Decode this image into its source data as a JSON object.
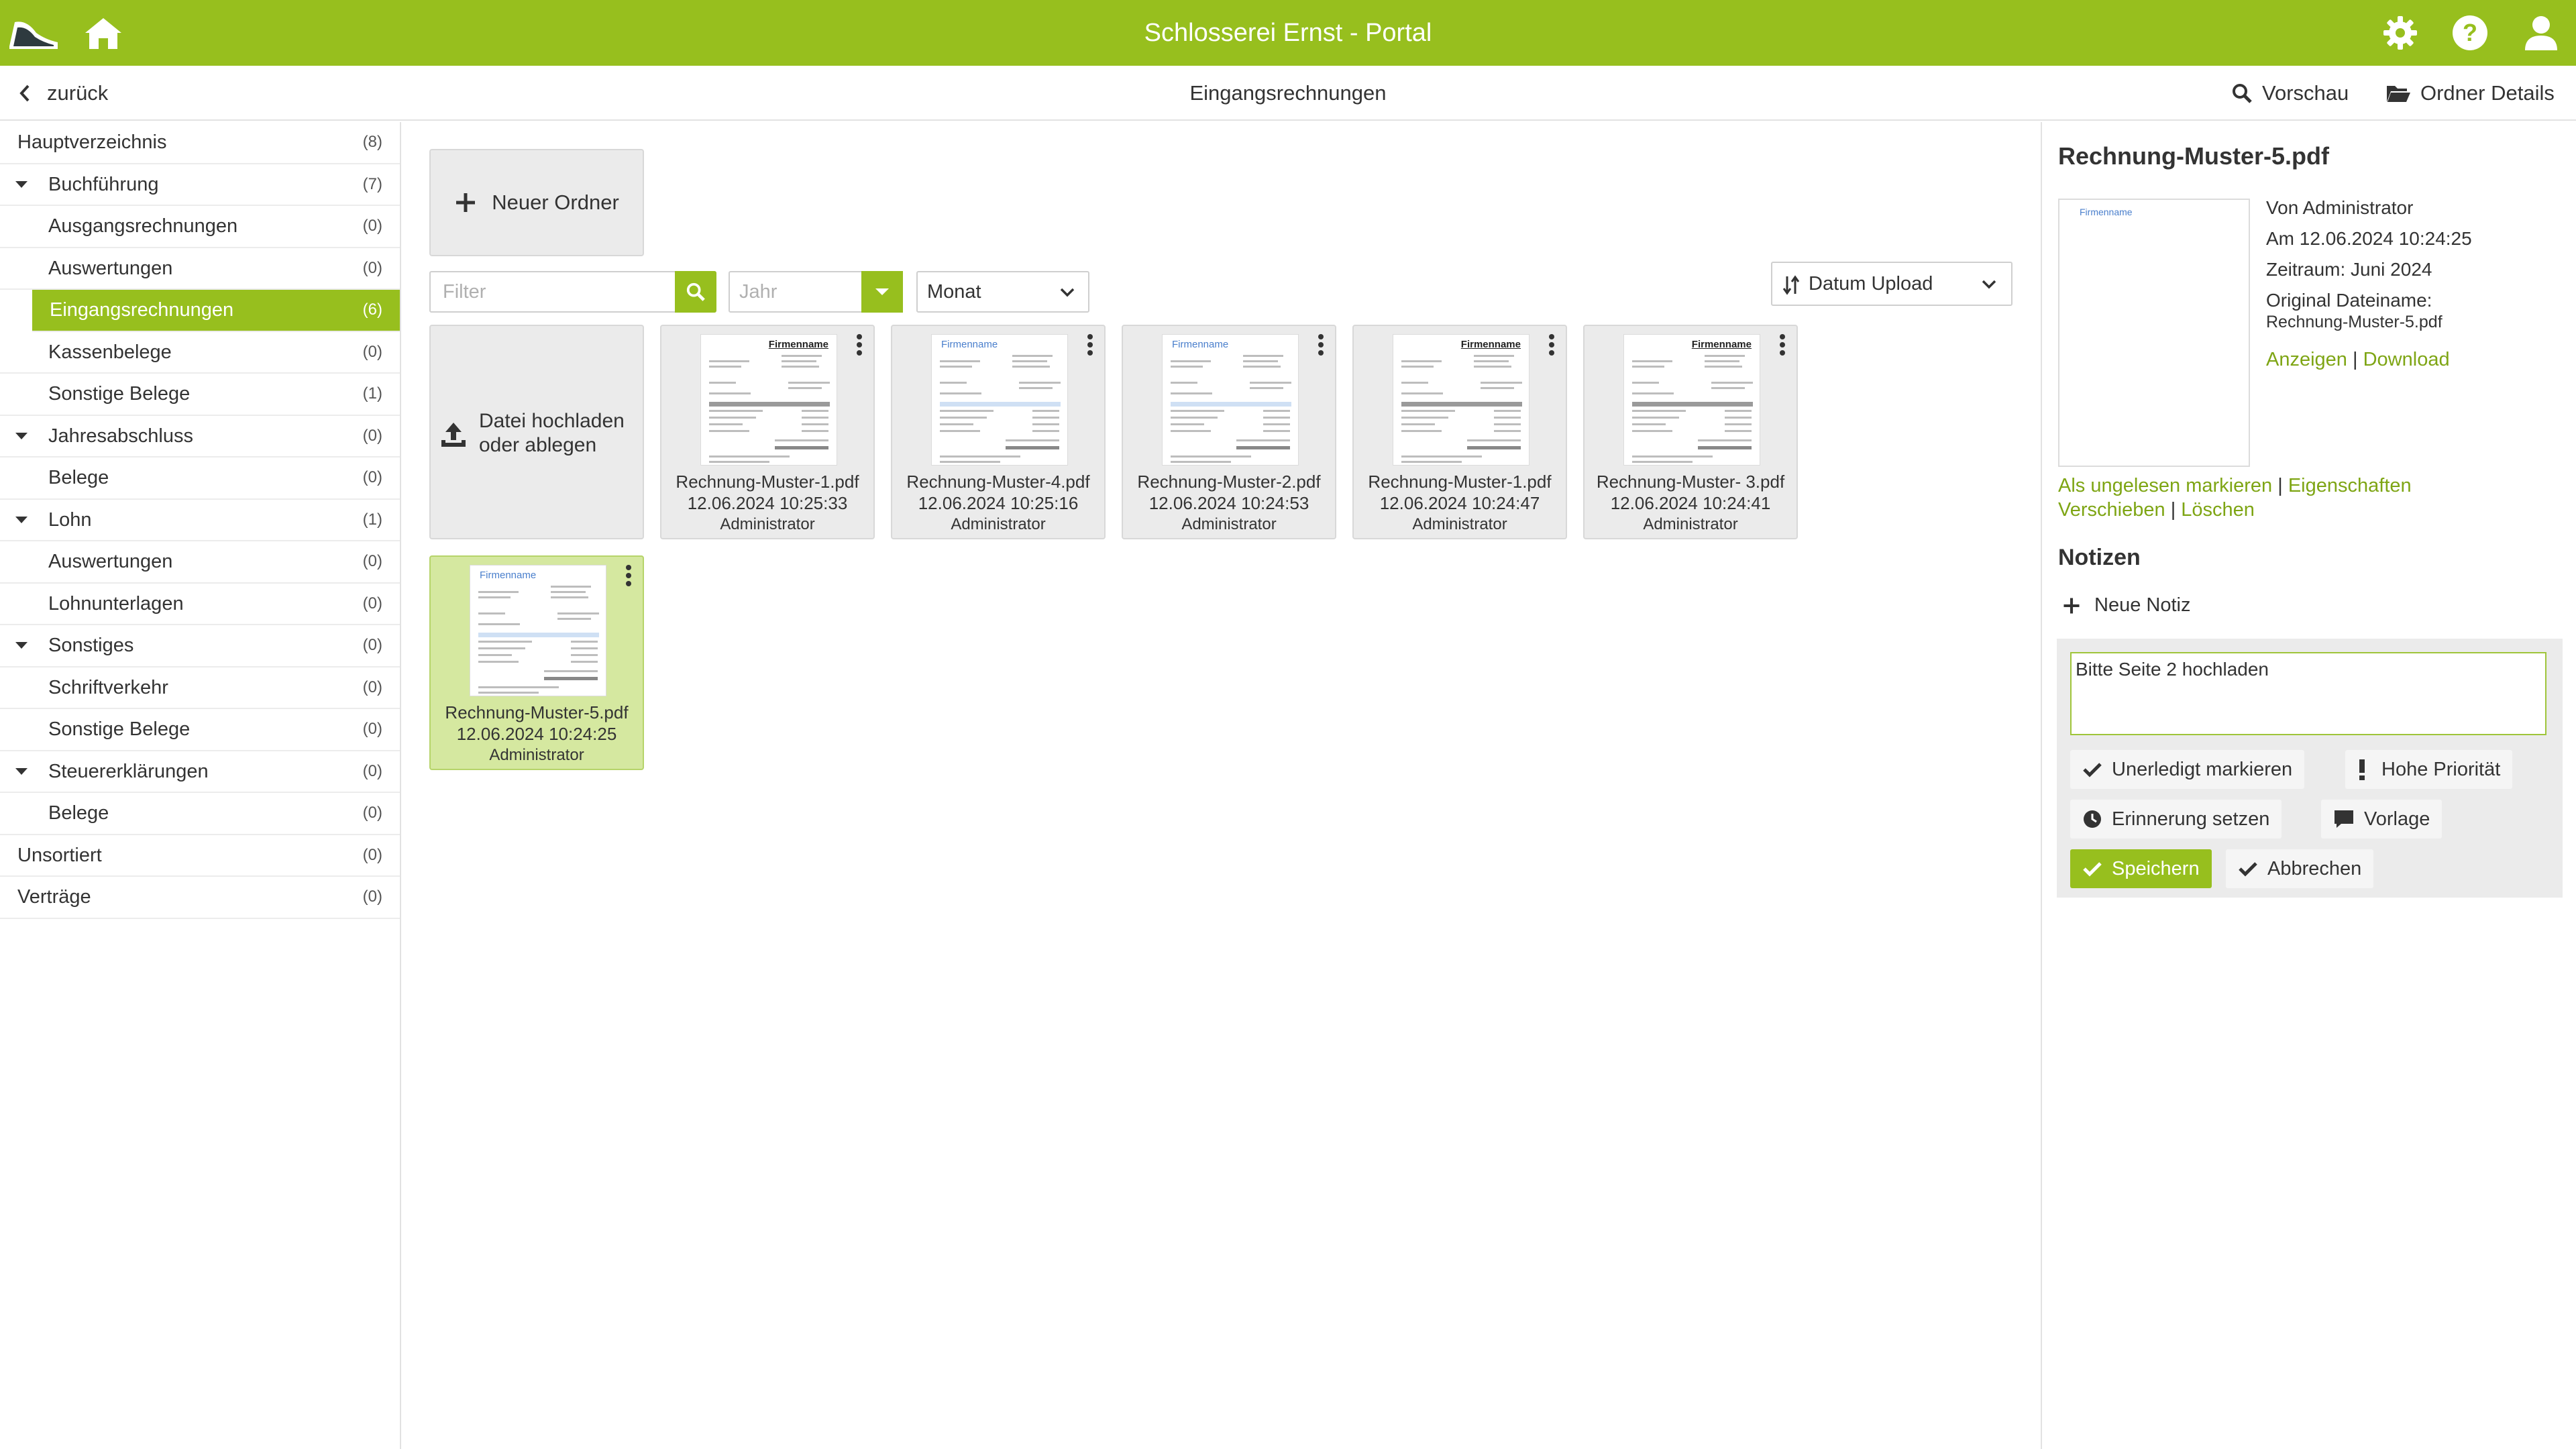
{
  "app": {
    "title": "Schlosserei Ernst - Portal"
  },
  "subbar": {
    "back_label": "zurück",
    "title": "Eingangsrechnungen",
    "preview_label": "Vorschau",
    "folder_details_label": "Ordner Details"
  },
  "sidebar": {
    "items": [
      {
        "label": "Hauptverzeichnis",
        "count": "(8)",
        "level": 0,
        "expandable": false,
        "active": false
      },
      {
        "label": "Buchführung",
        "count": "(7)",
        "level": 1,
        "expandable": true,
        "active": false
      },
      {
        "label": "Ausgangsrechnungen",
        "count": "(0)",
        "level": 2,
        "expandable": false,
        "active": false
      },
      {
        "label": "Auswertungen",
        "count": "(0)",
        "level": 2,
        "expandable": false,
        "active": false
      },
      {
        "label": "Eingangsrechnungen",
        "count": "(6)",
        "level": 2,
        "expandable": false,
        "active": true
      },
      {
        "label": "Kassenbelege",
        "count": "(0)",
        "level": 2,
        "expandable": false,
        "active": false
      },
      {
        "label": "Sonstige Belege",
        "count": "(1)",
        "level": 2,
        "expandable": false,
        "active": false
      },
      {
        "label": "Jahresabschluss",
        "count": "(0)",
        "level": 1,
        "expandable": true,
        "active": false
      },
      {
        "label": "Belege",
        "count": "(0)",
        "level": 2,
        "expandable": false,
        "active": false
      },
      {
        "label": "Lohn",
        "count": "(1)",
        "level": 1,
        "expandable": true,
        "active": false
      },
      {
        "label": "Auswertungen",
        "count": "(0)",
        "level": 2,
        "expandable": false,
        "active": false
      },
      {
        "label": "Lohnunterlagen",
        "count": "(0)",
        "level": 2,
        "expandable": false,
        "active": false
      },
      {
        "label": "Sonstiges",
        "count": "(0)",
        "level": 1,
        "expandable": true,
        "active": false
      },
      {
        "label": "Schriftverkehr",
        "count": "(0)",
        "level": 2,
        "expandable": false,
        "active": false
      },
      {
        "label": "Sonstige Belege",
        "count": "(0)",
        "level": 2,
        "expandable": false,
        "active": false
      },
      {
        "label": "Steuererklärungen",
        "count": "(0)",
        "level": 1,
        "expandable": true,
        "active": false
      },
      {
        "label": "Belege",
        "count": "(0)",
        "level": 2,
        "expandable": false,
        "active": false
      },
      {
        "label": "Unsortiert",
        "count": "(0)",
        "level": 0,
        "expandable": false,
        "active": false
      },
      {
        "label": "Verträge",
        "count": "(0)",
        "level": 0,
        "expandable": false,
        "active": false
      }
    ]
  },
  "toolbar": {
    "new_folder_label": "Neuer Ordner",
    "filter_placeholder": "Filter",
    "year_placeholder": "Jahr",
    "month_value": "Monat",
    "sort_value": "Datum Upload"
  },
  "upload": {
    "line1": "Datei hochladen",
    "line2": "oder ablegen"
  },
  "files": [
    {
      "name": "Rechnung-Muster-1.pdf",
      "date": "12.06.2024 10:25:33",
      "user": "Administrator",
      "logo": "Firmenname",
      "logo_style": "bold",
      "selected": false
    },
    {
      "name": "Rechnung-Muster-4.pdf",
      "date": "12.06.2024 10:25:16",
      "user": "Administrator",
      "logo": "Firmenname",
      "logo_style": "blue",
      "selected": false
    },
    {
      "name": "Rechnung-Muster-2.pdf",
      "date": "12.06.2024 10:24:53",
      "user": "Administrator",
      "logo": "Firmenname",
      "logo_style": "blue",
      "selected": false
    },
    {
      "name": "Rechnung-Muster-1.pdf",
      "date": "12.06.2024 10:24:47",
      "user": "Administrator",
      "logo": "Firmenname",
      "logo_style": "bold",
      "selected": false
    },
    {
      "name": "Rechnung-Muster- 3.pdf",
      "date": "12.06.2024 10:24:41",
      "user": "Administrator",
      "logo": "Firmenname",
      "logo_style": "bold",
      "selected": false
    },
    {
      "name": "Rechnung-Muster-5.pdf",
      "date": "12.06.2024 10:24:25",
      "user": "Administrator",
      "logo": "Firmenname",
      "logo_style": "blue",
      "selected": true
    }
  ],
  "details": {
    "filename": "Rechnung-Muster-5.pdf",
    "thumb_logo": "Firmenname",
    "by": "Von Administrator",
    "at": "Am 12.06.2024 10:24:25",
    "period": "Zeitraum: Juni 2024",
    "original_label": "Original Dateiname:",
    "original_name": "Rechnung-Muster-5.pdf",
    "view_link": "Anzeigen",
    "download_link": "Download",
    "mark_unread_link": "Als ungelesen markieren",
    "properties_link": "Eigenschaften",
    "move_link": "Verschieben",
    "delete_link": "Löschen",
    "separator": "|"
  },
  "notes": {
    "title": "Notizen",
    "new_note_label": "Neue Notiz",
    "text": "Bitte Seite 2 hochladen",
    "mark_open_label": "Unerledigt markieren",
    "priority_label": "Hohe Priorität",
    "reminder_label": "Erinnerung setzen",
    "template_label": "Vorlage",
    "save_label": "Speichern",
    "cancel_label": "Abbrechen"
  },
  "colors": {
    "accent": "#97bf1e",
    "link": "#7ea514",
    "selected_card": "#d5e8a0"
  }
}
